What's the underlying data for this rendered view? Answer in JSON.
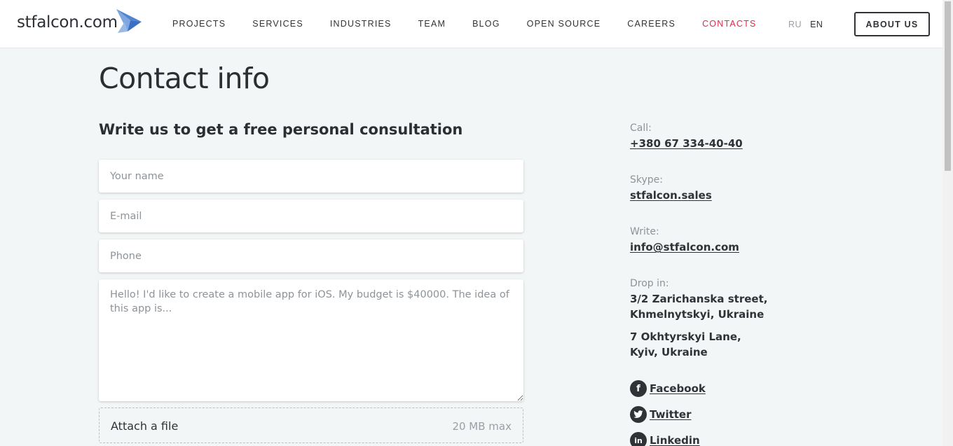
{
  "header": {
    "logo_text": "stfalcon.com",
    "nav": [
      {
        "label": "PROJECTS"
      },
      {
        "label": "SERVICES"
      },
      {
        "label": "INDUSTRIES"
      },
      {
        "label": "TEAM"
      },
      {
        "label": "BLOG"
      },
      {
        "label": "OPEN SOURCE"
      },
      {
        "label": "CAREERS"
      },
      {
        "label": "CONTACTS",
        "active": true
      }
    ],
    "lang": {
      "ru": "RU",
      "en": "EN"
    },
    "about_button": "ABOUT US"
  },
  "main": {
    "title": "Contact info",
    "subtitle": "Write us to get a free personal consultation",
    "form": {
      "name_placeholder": "Your name",
      "email_placeholder": "E-mail",
      "phone_placeholder": "Phone",
      "message_placeholder": "Hello! I'd like to create a mobile app for iOS. My budget is $40000. The idea of this app is...",
      "attach_label": "Attach a file",
      "attach_max": "20 MB max"
    }
  },
  "sidebar": {
    "call_label": "Call:",
    "call_value": "+380 67 334-40-40",
    "skype_label": "Skype:",
    "skype_value": "stfalcon.sales",
    "write_label": "Write:",
    "write_value": "info@stfalcon.com",
    "drop_label": "Drop in:",
    "address1_line1": "3/2 Zarichanska street,",
    "address1_line2": "Khmelnytskyi, Ukraine",
    "address2_line1": "7 Okhtyrskyi Lane,",
    "address2_line2": "Kyiv, Ukraine",
    "social": {
      "facebook": "Facebook",
      "twitter": "Twitter",
      "linkedin": "Linkedin"
    }
  },
  "colors": {
    "accent": "#e0294c",
    "text": "#2f3337",
    "background": "#f3f6f7",
    "logo_bird": "#5b8fd6"
  }
}
